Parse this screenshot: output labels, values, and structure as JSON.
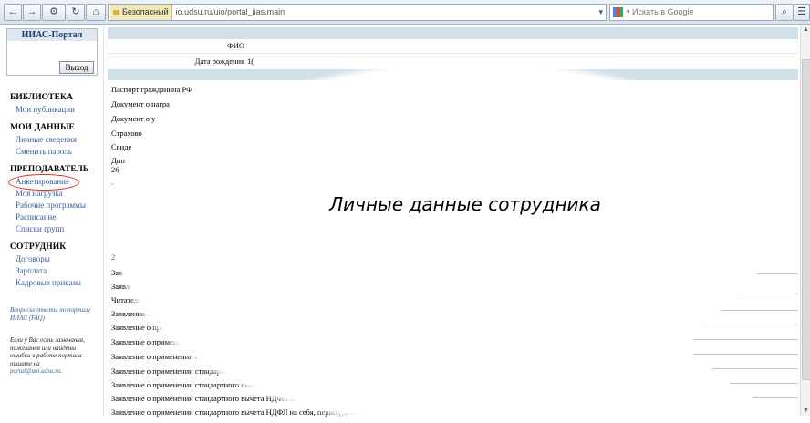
{
  "browser": {
    "security_badge": "Безопасный",
    "url": "io.udsu.ru/uio/portal_iias.main",
    "search_placeholder": "Искать в Google"
  },
  "sidebar": {
    "portal_title": "ИИАС-Портал",
    "exit_button": "Выход",
    "sections": [
      {
        "title": "БИБЛИОТЕКА",
        "items": [
          "Мои публикации"
        ]
      },
      {
        "title": "МОИ ДАННЫЕ",
        "items": [
          "Личные сведения",
          "Сменить пароль"
        ]
      },
      {
        "title": "ПРЕПОДАВАТЕЛЬ",
        "items": [
          "Анкетирование",
          "Моя нагрузка",
          "Рабочие программы",
          "Расписание",
          "Списки групп"
        ]
      },
      {
        "title": "СОТРУДНИК",
        "items": [
          "Договоры",
          "Зарплата",
          "Кадровые приказы"
        ]
      }
    ],
    "faq_text": "Вопросы/ответы по порталу ИИАС (FAQ)",
    "contact_text": "Если у Вас есть замечания, пожелания или найдены ошибки в работе портала пишите на",
    "contact_email": "portal@uni.udsu.ru."
  },
  "main": {
    "fio_label": "ФИО",
    "birth_label": "Дата рождения",
    "birth_value_partial": "1(",
    "documents": [
      "Паспорт гражданина РФ",
      "Документ о награ",
      "Документ о у",
      "Страхово",
      "Свиде",
      "Дип",
      "26",
      "Зав",
      "Заявл",
      "Читатель",
      "Заявление о",
      "Заявление о при",
      "Заявление о применен",
      "Заявление о применении ста",
      "Заявление о применении стандартног",
      "Заявление о применении стандартного вычета н",
      "Заявление о применении стандартного вычета НДФЛ на себя",
      "Заявление о применении стандартного вычета НДФЛ на себя, период действия с"
    ]
  },
  "overlay": {
    "caption": "Личные данные сотрудника"
  }
}
